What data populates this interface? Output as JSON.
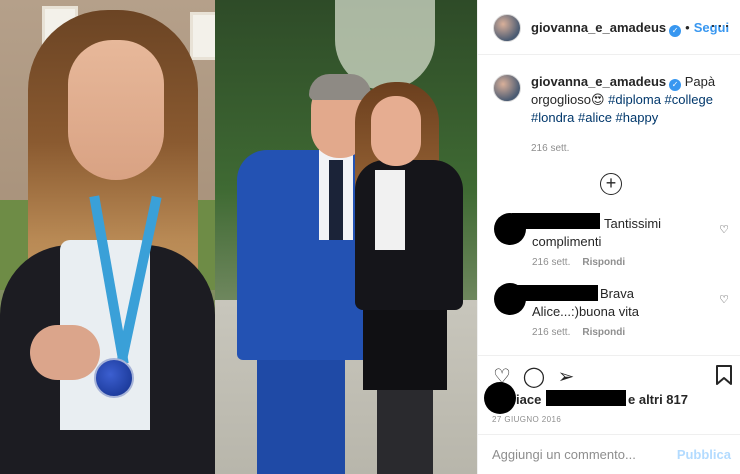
{
  "post": {
    "username": "giovanna_e_amadeus",
    "follow_label": "Segui",
    "more_icon": "more-dots-icon",
    "verified_icon": "verified-badge-icon"
  },
  "caption": {
    "username": "giovanna_e_amadeus",
    "text": "Papà orgoglioso😍",
    "hashtags": "#diploma #college #londra #alice #happy",
    "time": "216 sett."
  },
  "load_more_icon": "plus-circle-icon",
  "comments": [
    {
      "text": "Tantissimi complimenti",
      "time": "216 sett.",
      "reply_label": "Rispondi"
    },
    {
      "text": "Brava Alice...:)buona vita",
      "time": "216 sett.",
      "reply_label": "Rispondi"
    }
  ],
  "actions": {
    "like_icon": "heart-icon",
    "comment_icon": "comment-icon",
    "share_icon": "share-icon",
    "save_icon": "bookmark-icon"
  },
  "likes": {
    "prefix": "iace",
    "suffix": "e altri 817"
  },
  "date": "27 giugno 2016",
  "add_comment": {
    "placeholder": "Aggiungi un commento...",
    "post_label": "Pubblica"
  },
  "colors": {
    "accent": "#3897f0",
    "hashtag": "#00376b",
    "muted": "#8e8e8e",
    "post_disabled": "#b3dbff"
  }
}
